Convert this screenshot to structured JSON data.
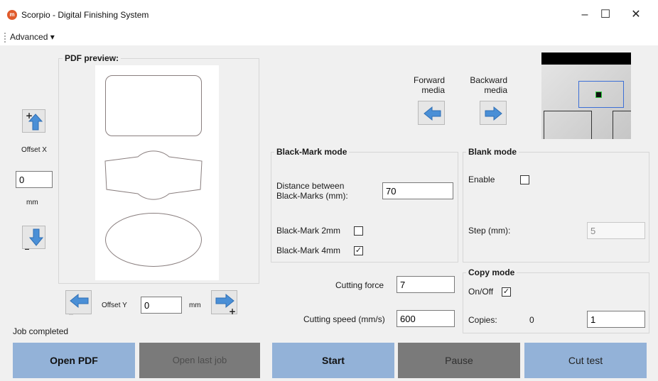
{
  "window": {
    "title": "Scorpio - Digital Finishing System",
    "icon_letter": "m",
    "minimize": "–",
    "maximize": "☐",
    "close": "✕"
  },
  "menu": {
    "advanced": "Advanced ▾"
  },
  "preview": {
    "title": "PDF preview:"
  },
  "offset_x": {
    "label": "Offset X",
    "value": "0",
    "unit": "mm"
  },
  "offset_y": {
    "label": "Offset Y",
    "value": "0",
    "unit": "mm"
  },
  "media": {
    "forward": "Forward media",
    "backward": "Backward media"
  },
  "black_mark": {
    "title": "Black-Mark mode",
    "distance_label": "Distance between Black-Marks (mm):",
    "distance_value": "70",
    "mark2_label": "Black-Mark 2mm",
    "mark2_checked": "",
    "mark4_label": "Black-Mark 4mm",
    "mark4_checked": "✓"
  },
  "blank_mode": {
    "title": "Blank mode",
    "enable_label": "Enable",
    "enable_checked": "",
    "step_label": "Step (mm):",
    "step_value": "5"
  },
  "cutting": {
    "force_label": "Cutting force",
    "force_value": "7",
    "speed_label": "Cutting speed (mm/s)",
    "speed_value": "600"
  },
  "copy_mode": {
    "title": "Copy mode",
    "onoff_label": "On/Off",
    "onoff_checked": "✓",
    "copies_label": "Copies:",
    "copies_count": "0",
    "copies_value": "1"
  },
  "status": {
    "text": "Job completed"
  },
  "buttons": {
    "open_pdf": "Open PDF",
    "open_last_job": "Open last job",
    "start": "Start",
    "pause": "Pause",
    "cut_test": "Cut test"
  },
  "colors": {
    "button_blue": "#93b2d8",
    "button_gray": "#7a7a7a",
    "arrow_blue": "#4a8fd6"
  }
}
